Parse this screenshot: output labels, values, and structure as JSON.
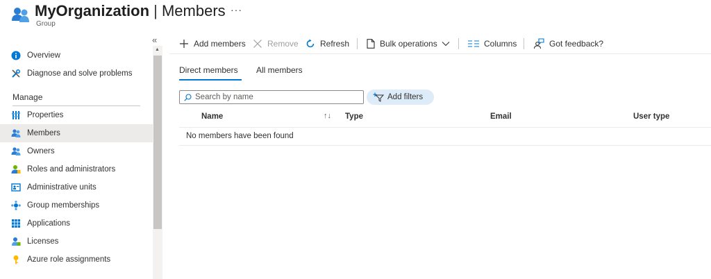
{
  "header": {
    "org": "MyOrganization",
    "separator": "|",
    "page": "Members",
    "subtitle": "Group",
    "more": "···"
  },
  "sidebar": {
    "collapse": "«",
    "items_top": [
      {
        "label": "Overview",
        "icon": "info-icon"
      },
      {
        "label": "Diagnose and solve problems",
        "icon": "wrench-icon"
      }
    ],
    "section": "Manage",
    "items": [
      {
        "label": "Properties",
        "icon": "properties-icon"
      },
      {
        "label": "Members",
        "icon": "members-icon",
        "active": true
      },
      {
        "label": "Owners",
        "icon": "owners-icon"
      },
      {
        "label": "Roles and administrators",
        "icon": "roles-icon"
      },
      {
        "label": "Administrative units",
        "icon": "admin-units-icon"
      },
      {
        "label": "Group memberships",
        "icon": "group-memberships-icon"
      },
      {
        "label": "Applications",
        "icon": "applications-icon"
      },
      {
        "label": "Licenses",
        "icon": "licenses-icon"
      },
      {
        "label": "Azure role assignments",
        "icon": "key-icon"
      }
    ]
  },
  "toolbar": {
    "add": "Add members",
    "remove": "Remove",
    "refresh": "Refresh",
    "bulk": "Bulk operations",
    "columns": "Columns",
    "feedback": "Got feedback?"
  },
  "tabs": {
    "direct": "Direct members",
    "all": "All members"
  },
  "search": {
    "placeholder": "Search by name"
  },
  "filters": {
    "label": "Add filters"
  },
  "table": {
    "columns": [
      "Name",
      "Type",
      "Email",
      "User type"
    ],
    "empty_message": "No members have been found"
  },
  "colors": {
    "accent": "#0078d4",
    "active_bg": "#edebe9",
    "filter_bg": "#deecf9"
  }
}
